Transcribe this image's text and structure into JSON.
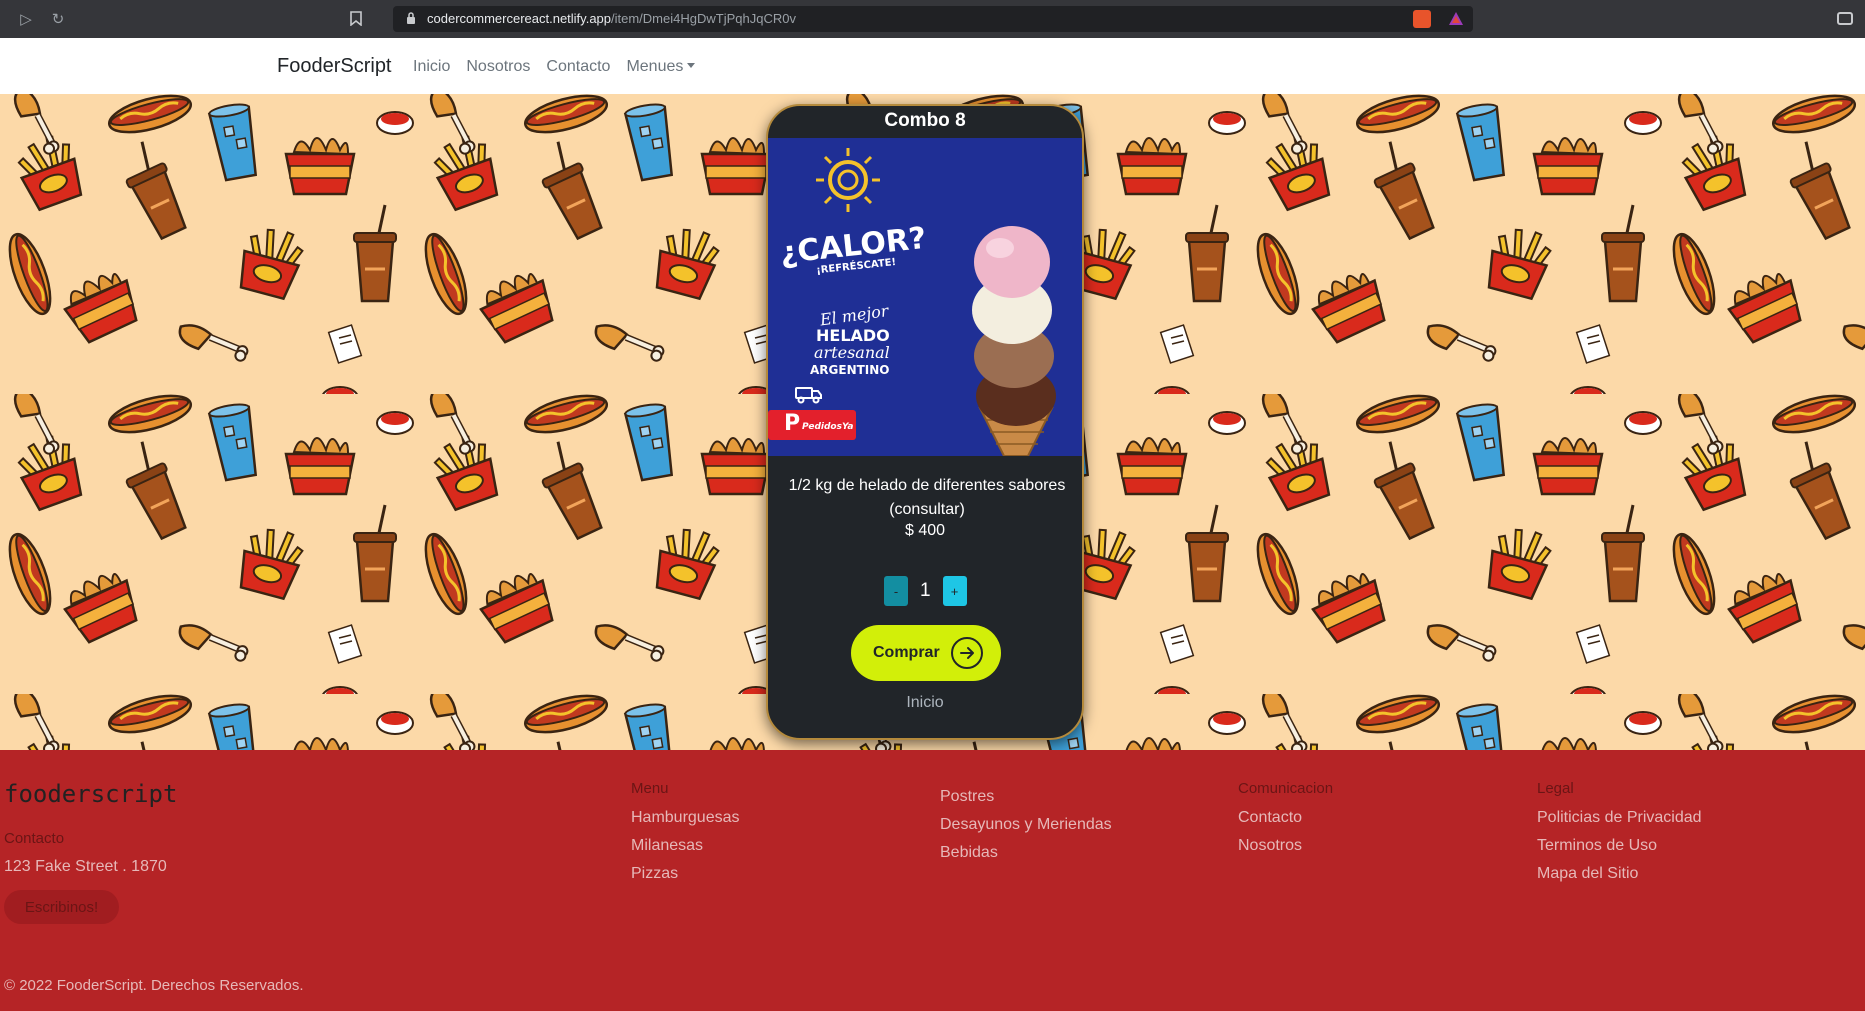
{
  "browser": {
    "url_host": "codercommercereact.netlify.app",
    "url_path": "/item/Dmei4HgDwTjPqhJqCR0v"
  },
  "navbar": {
    "brand": "FooderScript",
    "links": [
      "Inicio",
      "Nosotros",
      "Contacto",
      "Menues"
    ]
  },
  "card": {
    "title": "Combo 8",
    "description": "1/2 kg de helado de diferentes sabores (consultar)",
    "price": "$ 400",
    "quantity": "1",
    "minus_label": "-",
    "plus_label": "+",
    "buy_label": "Comprar",
    "home_link": "Inicio",
    "image": {
      "headline": "¿CALOR?",
      "subline": "¡REFRÉSCATE!",
      "tag1": "El mejor",
      "tag2": "HELADO",
      "tag3": "artesanal",
      "tag4": "ARGENTINO",
      "badge": "PedidosYa"
    }
  },
  "footer": {
    "logo": "fooderscript",
    "contact_heading": "Contacto",
    "address": "123 Fake Street . 1870",
    "write_button": "Escribinos!",
    "menu": {
      "heading": "Menu",
      "items": [
        "Hamburguesas",
        "Milanesas",
        "Pizzas"
      ]
    },
    "menu2": {
      "items": [
        "Postres",
        "Desayunos y Meriendas",
        "Bebidas"
      ]
    },
    "comunicacion": {
      "heading": "Comunicacion",
      "items": [
        "Contacto",
        "Nosotros"
      ]
    },
    "legal": {
      "heading": "Legal",
      "items": [
        "Politicias de Privacidad",
        "Terminos de Uso",
        "Mapa del Sitio"
      ]
    },
    "copyright": "© 2022 FooderScript. Derechos Reservados."
  },
  "colors": {
    "accent": "#d2ef09",
    "footer_bg": "#b52426",
    "card_bg": "#212529",
    "hero_bg": "#fcd9a8"
  }
}
